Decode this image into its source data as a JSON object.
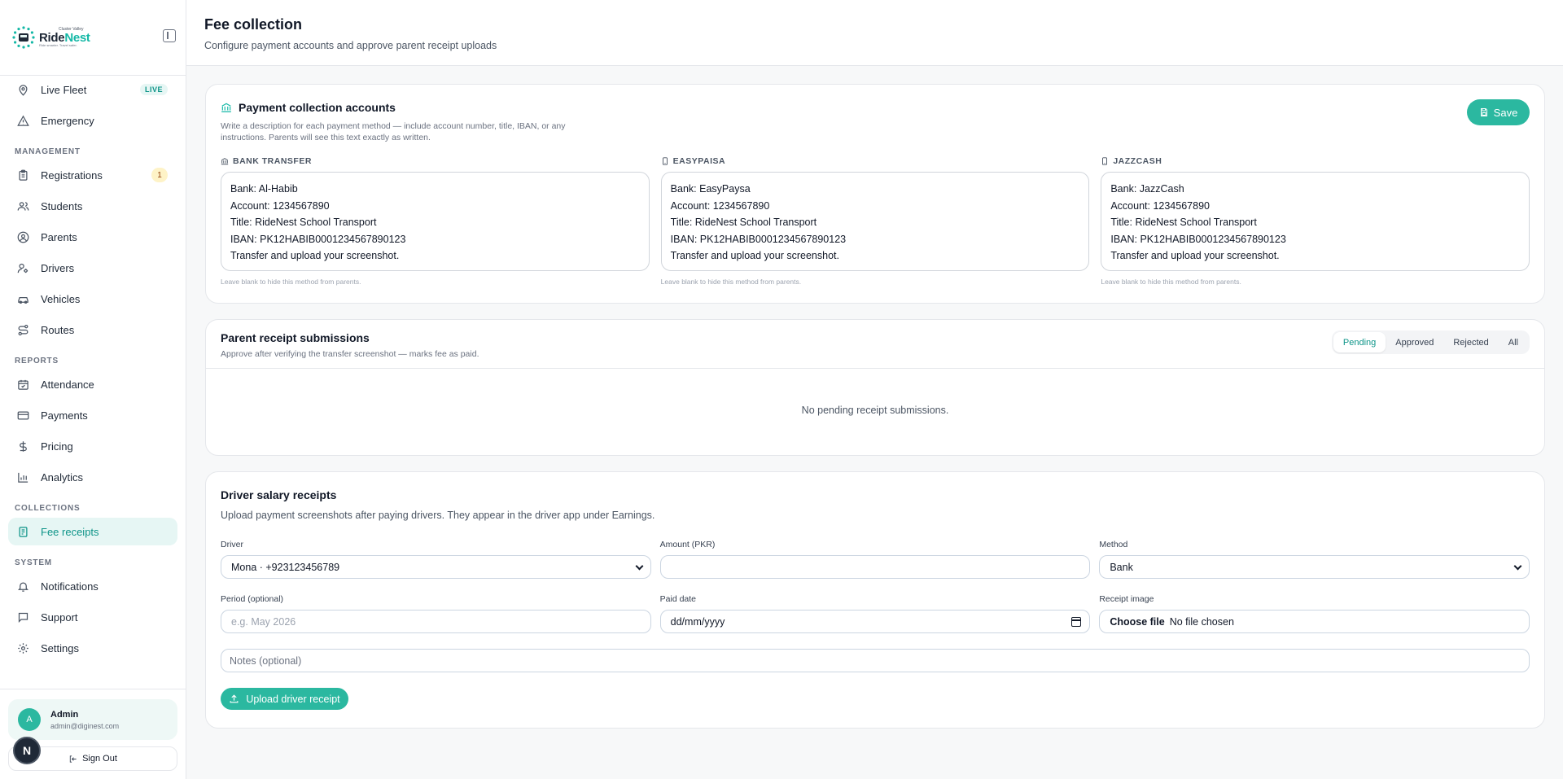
{
  "brand": {
    "top": "Cluster Valley",
    "name_a": "Ride",
    "name_b": "Nest",
    "tag": "Ride smarter. Travel safer."
  },
  "nav": {
    "live_fleet": "Live Fleet",
    "live_badge": "LIVE",
    "emergency": "Emergency",
    "management_label": "MANAGEMENT",
    "registrations": "Registrations",
    "registrations_count": "1",
    "students": "Students",
    "parents": "Parents",
    "drivers": "Drivers",
    "vehicles": "Vehicles",
    "routes": "Routes",
    "reports_label": "REPORTS",
    "attendance": "Attendance",
    "payments": "Payments",
    "pricing": "Pricing",
    "analytics": "Analytics",
    "collections_label": "COLLECTIONS",
    "fee_receipts": "Fee receipts",
    "system_label": "SYSTEM",
    "notifications": "Notifications",
    "support": "Support",
    "settings": "Settings"
  },
  "user": {
    "initial": "A",
    "name": "Admin",
    "email": "admin@diginest.com",
    "sign_out": "Sign Out",
    "n_badge": "N"
  },
  "header": {
    "title": "Fee collection",
    "subtitle": "Configure payment accounts and approve parent receipt uploads"
  },
  "payment_accounts": {
    "title": "Payment collection accounts",
    "description": "Write a description for each payment method — include account number, title, IBAN, or any instructions. Parents will see this text exactly as written.",
    "save": "Save",
    "hint": "Leave blank to hide this method from parents.",
    "methods": [
      {
        "label": "BANK TRANSFER",
        "text": "Bank: Al-Habib\nAccount: 1234567890\nTitle: RideNest School Transport\nIBAN: PK12HABIB0001234567890123\nTransfer and upload your screenshot."
      },
      {
        "label": "EASYPAISA",
        "text": "Bank: EasyPaysa\nAccount: 1234567890\nTitle: RideNest School Transport\nIBAN: PK12HABIB0001234567890123\nTransfer and upload your screenshot."
      },
      {
        "label": "JAZZCASH",
        "text": "Bank: JazzCash\nAccount: 1234567890\nTitle: RideNest School Transport\nIBAN: PK12HABIB0001234567890123\nTransfer and upload your screenshot."
      }
    ]
  },
  "receipts": {
    "title": "Parent receipt submissions",
    "description": "Approve after verifying the transfer screenshot — marks fee as paid.",
    "tabs": [
      "Pending",
      "Approved",
      "Rejected",
      "All"
    ],
    "active_tab": "Pending",
    "empty": "No pending receipt submissions."
  },
  "salary": {
    "title": "Driver salary receipts",
    "description": "Upload payment screenshots after paying drivers. They appear in the driver app under Earnings.",
    "driver_label": "Driver",
    "driver_value": "Mona · +923123456789",
    "amount_label": "Amount (PKR)",
    "amount_value": "",
    "method_label": "Method",
    "method_value": "Bank",
    "period_label": "Period (optional)",
    "period_placeholder": "e.g. May 2026",
    "paid_date_label": "Paid date",
    "paid_date_placeholder": "dd/mm/yyyy",
    "receipt_label": "Receipt image",
    "choose_file": "Choose file",
    "no_file": "No file chosen",
    "notes_placeholder": "Notes (optional)",
    "upload": "Upload driver receipt"
  },
  "colors": {
    "accent": "#2bb8a0",
    "accent_dark": "#0d9488",
    "active_bg": "#e6f6f4"
  }
}
